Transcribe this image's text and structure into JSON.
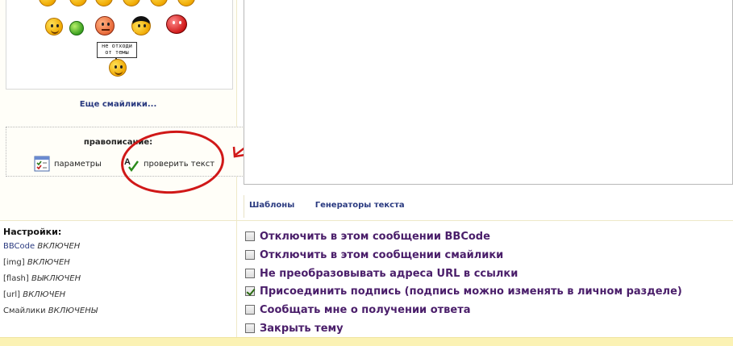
{
  "smileys": {
    "sign_line1": "не отходи",
    "sign_line2": "от темы",
    "more_link": "Еще смайлики..."
  },
  "spelling": {
    "title": "правописание:",
    "params_label": "параметры",
    "check_label": "проверить текст"
  },
  "editor": {
    "tabs": [
      "Шаблоны",
      "Генераторы текста"
    ]
  },
  "settings": {
    "title": "Настройки:",
    "items": [
      {
        "name": "BBCode",
        "state": "ВКЛЮЧЕН"
      },
      {
        "name": "[img]",
        "state": "ВКЛЮЧЕН"
      },
      {
        "name": "[flash]",
        "state": "ВЫКЛЮЧЕН"
      },
      {
        "name": "[url]",
        "state": "ВКЛЮЧЕН"
      },
      {
        "name": "Смайлики",
        "state": "ВКЛЮЧЕНЫ"
      }
    ]
  },
  "options": [
    {
      "label": "Отключить в этом сообщении BBCode",
      "checked": false
    },
    {
      "label": "Отключить в этом сообщении смайлики",
      "checked": false
    },
    {
      "label": "Не преобразовывать адреса URL в ссылки",
      "checked": false
    },
    {
      "label": "Присоединить подпись (подпись можно изменять в личном разделе)",
      "checked": true
    },
    {
      "label": "Сообщать мне о получении ответа",
      "checked": false
    },
    {
      "label": "Закрыть тему",
      "checked": false
    }
  ],
  "colors": {
    "accent_link": "#2a3a80",
    "option_text": "#4a1e6a",
    "annotation_red": "#d01818"
  }
}
